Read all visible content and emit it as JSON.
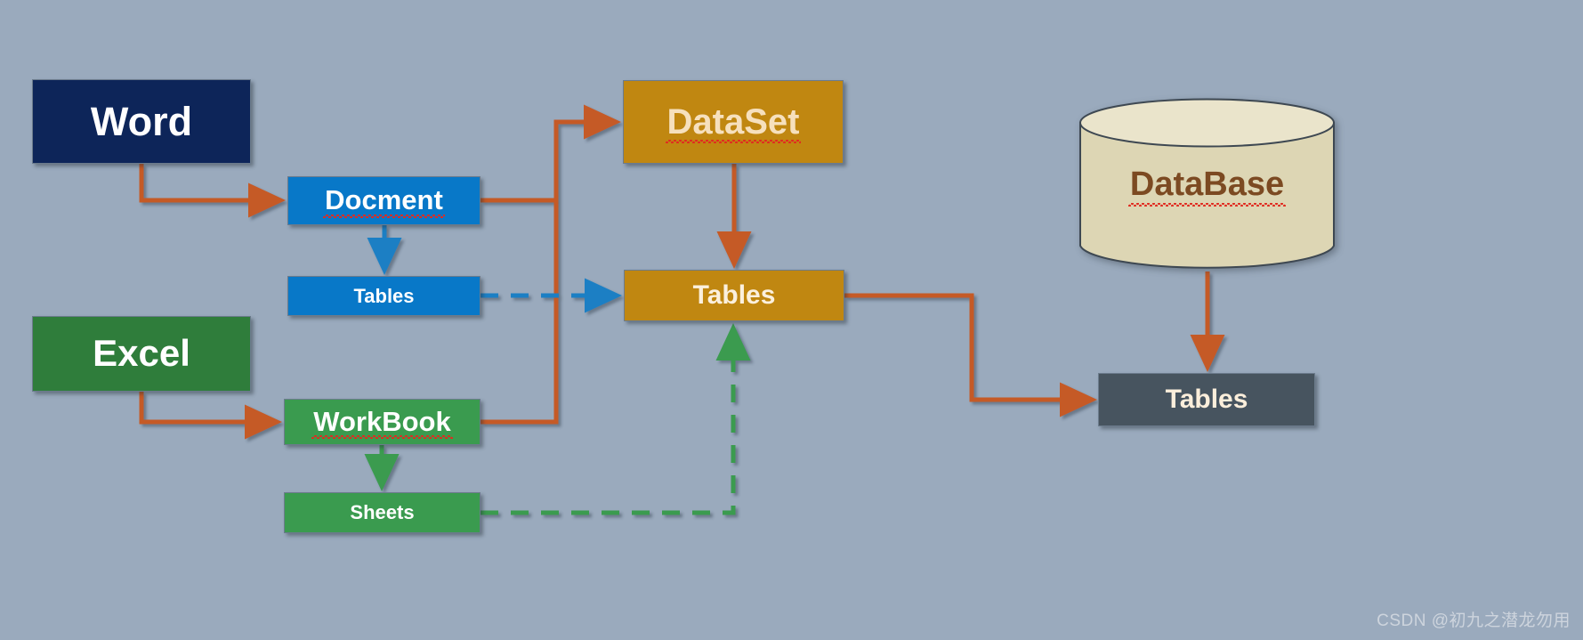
{
  "diagram": {
    "background_color": "#9aaabd",
    "nodes": {
      "word": {
        "label": "Word",
        "color": "#0d2559",
        "text_color": "#ffffff"
      },
      "excel": {
        "label": "Excel",
        "color": "#2f7d3b",
        "text_color": "#ffffff"
      },
      "docment": {
        "label": "Docment",
        "color": "#0878c8",
        "text_color": "#ffffff",
        "spellcheck_error": true
      },
      "doc_tables": {
        "label": "Tables",
        "color": "#0878c8",
        "text_color": "#ffffff"
      },
      "workbook": {
        "label": "WorkBook",
        "color": "#3a9b4f",
        "text_color": "#ffffff",
        "spellcheck_error": true
      },
      "sheets": {
        "label": "Sheets",
        "color": "#3a9b4f",
        "text_color": "#ffffff"
      },
      "dataset": {
        "label": "DataSet",
        "color": "#c08711",
        "text_color": "#f6e0bd",
        "spellcheck_error": true
      },
      "dataset_tables": {
        "label": "Tables",
        "color": "#c08711",
        "text_color": "#fbf0de"
      },
      "database": {
        "label": "DataBase",
        "color": "#ddd6b4",
        "text_color": "#7c4a22",
        "spellcheck_error": true
      },
      "database_tables": {
        "label": "Tables",
        "color": "#47545f",
        "text_color": "#fbeedb"
      }
    },
    "edges": [
      {
        "from": "word",
        "to": "docment",
        "style": "solid",
        "color": "#c55a28"
      },
      {
        "from": "docment",
        "to": "doc_tables",
        "style": "solid",
        "color": "#1b7fc4"
      },
      {
        "from": "docment",
        "to": "dataset",
        "style": "solid",
        "color": "#c55a28"
      },
      {
        "from": "excel",
        "to": "workbook",
        "style": "solid",
        "color": "#c55a28"
      },
      {
        "from": "workbook",
        "to": "sheets",
        "style": "solid",
        "color": "#3a9b4f"
      },
      {
        "from": "workbook",
        "to": "dataset",
        "style": "solid",
        "color": "#c55a28"
      },
      {
        "from": "dataset",
        "to": "dataset_tables",
        "style": "solid",
        "color": "#c55a28"
      },
      {
        "from": "doc_tables",
        "to": "dataset_tables",
        "style": "dashed",
        "color": "#1b7fc4"
      },
      {
        "from": "sheets",
        "to": "dataset_tables",
        "style": "dashed",
        "color": "#3a9b4f"
      },
      {
        "from": "dataset_tables",
        "to": "database_tables",
        "style": "solid",
        "color": "#c55a28"
      },
      {
        "from": "database",
        "to": "database_tables",
        "style": "solid",
        "color": "#c55a28"
      }
    ]
  },
  "watermark": {
    "text": "CSDN @初九之潜龙勿用"
  }
}
